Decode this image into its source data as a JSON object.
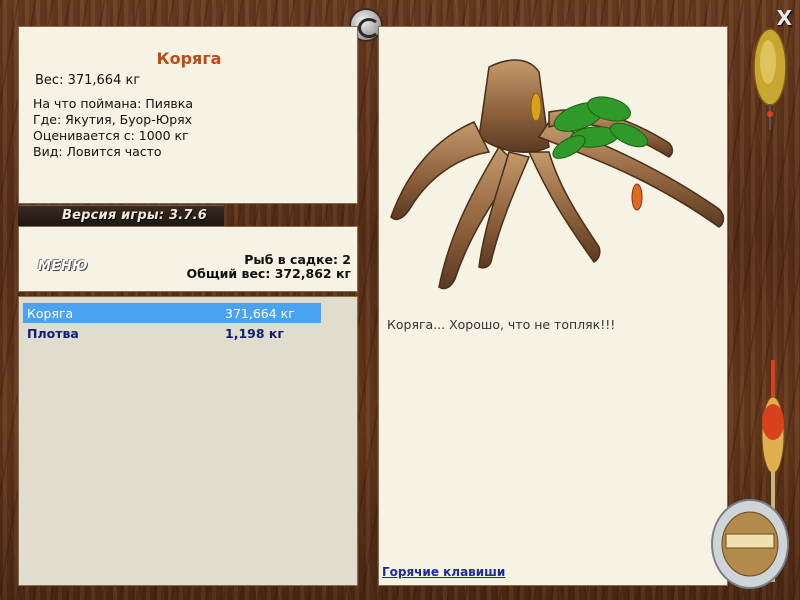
{
  "info": {
    "fish_name": "Коряга",
    "weight": "Вес: 371,664 кг",
    "caught_on": "На что поймана: Пиявка",
    "location": "Где: Якутия, Буор-Юрях",
    "valued_from": "Оценивается с: 1000 кг",
    "frequency": "Вид: Ловится часто"
  },
  "version": "Версия игры: 3.7.6",
  "menu": {
    "label": "МЕНЮ",
    "fish_count": "Рыб в садке: 2",
    "total_weight": "Общий вес: 372,862 кг"
  },
  "catch_list": [
    {
      "name": "Коряга",
      "weight": "371,664 кг",
      "selected": true
    },
    {
      "name": "Плотва",
      "weight": "1,198 кг",
      "selected": false
    }
  ],
  "main": {
    "caption": "Коряга... Хорошо, что не топляк!!!",
    "hotkeys_link": "Горячие клавиши"
  },
  "close_label": "X",
  "colors": {
    "title": "#c04a12",
    "selection": "#4aa3f0",
    "list_text": "#10207a",
    "link": "#1a2aa8"
  },
  "icons": [
    "game-logo-icon",
    "close-icon",
    "spoon-lure-icon",
    "float-bobber-icon",
    "line-spool-icon"
  ]
}
